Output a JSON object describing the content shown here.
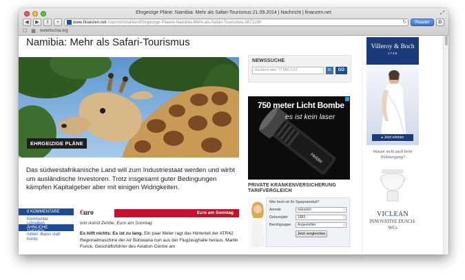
{
  "window": {
    "title": "Ehrgeizige Pläne: Namibia: Mehr als Safari-Tourismus 21.09.2014 | Nachricht | finanzen.net",
    "url_domain": "www.finanzen.net",
    "url_path": "/nachricht/aktien/Ehrgeizige-Plaene-Namibia-Mehr-als-Safari-Tourismus-3871280",
    "reader_label": "Reader",
    "bookmark": "welwitschia.org",
    "back_label": "◀",
    "forward_label": "▶",
    "share_label": "⇪",
    "add_label": "+",
    "reload_label": "↻",
    "settings_label": "⚙"
  },
  "article": {
    "headline": "Namibia: Mehr als Safari-Tourismus",
    "hero_label": "EHRGEIZIGE PLÄNE",
    "lead": "Das südwestafrikanische Land will zum Industriestaat werden und wirbt um ausländische Investoren. Trotz insgesamt guter Bedingungen kämpfen Kapitalgeber aber mit einigen Widrigkeiten.",
    "source_logo_prefix": "€",
    "source_logo_word": "uro",
    "source_strip": "€uro am Sonntag",
    "byline": "von Astrid Zehbe, Euro am Sonntag",
    "body_bold": "Es hilft nichts: Es ist zu lang.",
    "body": " Ein paar Meter ragt das Hinterteil der ATR42 Regionalmaschine der Air Botswana nun aus der Flugzeughalle heraus. Martin Funck, Geschäftsführer des Aviation Centre am"
  },
  "leftnav": {
    "comments_header": "0 KOMMENTARE",
    "write_comment": "Kommenter schreiben",
    "related_header": "ÄHNLICHE THEMEN",
    "related_item": "Indien: Bares statt Konto"
  },
  "newssuche": {
    "title": "NEWSSUCHE",
    "placeholder": "Suchtext oder TT.MM.JJJJ",
    "go_label": "GO",
    "calendar_label": "31"
  },
  "ad_torch": {
    "line1": "750 meter Licht Bombe",
    "line2": "es ist kein laser"
  },
  "krankenversicherung": {
    "title": "PRIVATE KRANKENVERSICHERUNG TARIFVERGLEICH",
    "question": "Wie hoch ist Ihr Sparpotential?",
    "fields": [
      {
        "label": "Anrede",
        "value": "männlich"
      },
      {
        "label": "Geburtsjahr",
        "value": "1983"
      },
      {
        "label": "Berufsgruppe",
        "value": "Angestellter"
      }
    ],
    "button": "Jetzt vergleichen"
  },
  "sidebar_ad": {
    "brand": "Villeroy & Boch",
    "year": "1748",
    "cta": "▸ Jetzt erleben",
    "question": "Warum nicht auch beim Toilettengang?",
    "product": "VICLEAN",
    "subtitle": "INNOVATIVE DUSCH-WCs"
  },
  "colors": {
    "accent_blue": "#1c4d96",
    "euro_red": "#c8102e",
    "vb_blue": "#1c3b7a"
  }
}
